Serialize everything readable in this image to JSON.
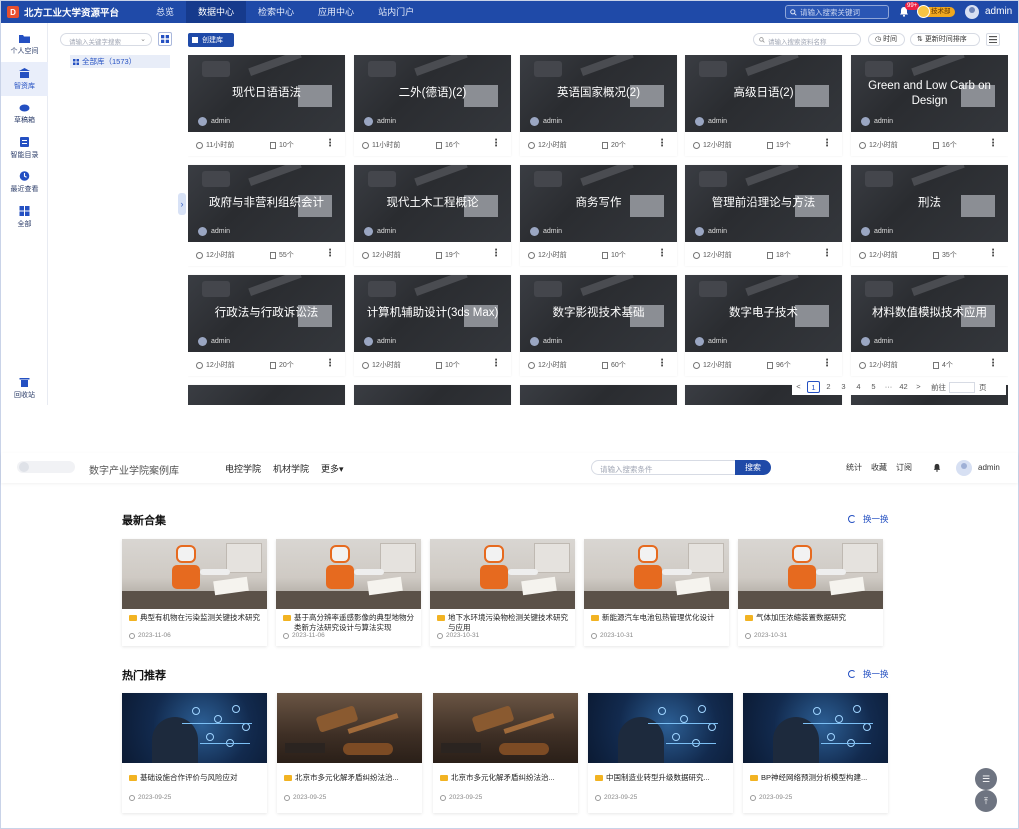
{
  "app": {
    "brand": "北方工业大学资源平台",
    "logo_letter": "D",
    "nav": [
      "总览",
      "数据中心",
      "检索中心",
      "应用中心",
      "站内门户"
    ],
    "nav_active": 1,
    "search_placeholder": "请输入搜索关键词",
    "notif_count": "99+",
    "vip_label": "技术部",
    "user": "admin"
  },
  "sidebar": [
    {
      "label": "个人空间",
      "icon": "folder-icon"
    },
    {
      "label": "智资库",
      "icon": "library-icon",
      "active": true
    },
    {
      "label": "草稿箱",
      "icon": "cloud-icon"
    },
    {
      "label": "智能目录",
      "icon": "catalog-icon"
    },
    {
      "label": "最近查看",
      "icon": "clock-icon"
    },
    {
      "label": "全部",
      "icon": "grid-icon"
    }
  ],
  "sidebar_bottom": {
    "label": "回收站",
    "icon": "trash-icon"
  },
  "tree": {
    "search_placeholder": "请输入关键字搜索",
    "root_label": "全部库（1573）"
  },
  "toolbar": {
    "new_lib": "创建库",
    "search_placeholder": "请输入搜索资料名称",
    "sort_time": "时间",
    "sort_update": "更新时间排序"
  },
  "cards": [
    {
      "title": "现代日语语法",
      "author": "admin",
      "time": "11小时前",
      "count": "10个"
    },
    {
      "title": "二外(德语)(2)",
      "author": "admin",
      "time": "11小时前",
      "count": "16个"
    },
    {
      "title": "英语国家概况(2)",
      "author": "admin",
      "time": "12小时前",
      "count": "20个"
    },
    {
      "title": "高级日语(2)",
      "author": "admin",
      "time": "12小时前",
      "count": "19个"
    },
    {
      "title": "Green and Low Carb on Design",
      "author": "admin",
      "time": "12小时前",
      "count": "16个"
    },
    {
      "title": "政府与非营利组织会计",
      "author": "admin",
      "time": "12小时前",
      "count": "55个"
    },
    {
      "title": "现代土木工程概论",
      "author": "admin",
      "time": "12小时前",
      "count": "19个"
    },
    {
      "title": "商务写作",
      "author": "admin",
      "time": "12小时前",
      "count": "10个"
    },
    {
      "title": "管理前沿理论与方法",
      "author": "admin",
      "time": "12小时前",
      "count": "18个"
    },
    {
      "title": "刑法",
      "author": "admin",
      "time": "12小时前",
      "count": "35个"
    },
    {
      "title": "行政法与行政诉讼法",
      "author": "admin",
      "time": "12小时前",
      "count": "20个"
    },
    {
      "title": "计算机辅助设计(3ds Max)",
      "author": "admin",
      "time": "12小时前",
      "count": "10个"
    },
    {
      "title": "数字影视技术基础",
      "author": "admin",
      "time": "12小时前",
      "count": "60个"
    },
    {
      "title": "数字电子技术",
      "author": "admin",
      "time": "12小时前",
      "count": "96个"
    },
    {
      "title": "材料数值模拟技术应用",
      "author": "admin",
      "time": "12小时前",
      "count": "4个"
    }
  ],
  "pager": {
    "prev": "<",
    "pages": [
      "1",
      "2",
      "3",
      "4",
      "5",
      "···",
      "42"
    ],
    "active": 0,
    "next": ">",
    "goto": "前往",
    "confirm": "页"
  },
  "portal": {
    "title": "数字产业学院案例库",
    "links": [
      "电控学院",
      "机材学院",
      "更多▾"
    ],
    "search_placeholder": "请输入搜索条件",
    "search_btn": "搜索",
    "right": [
      "统计",
      "收藏",
      "订阅"
    ],
    "user": "admin",
    "latest_title": "最新合集",
    "hot_title": "热门推荐",
    "refresh": "换一换",
    "latest": [
      {
        "title": "典型有机物在污染监测关键技术研究",
        "date": "2023-11-06"
      },
      {
        "title": "基于高分辨率遥感影像的典型地物分类新方法研究设计与算法实现",
        "date": "2023-11-06"
      },
      {
        "title": "地下水环境污染物检测关键技术研究与应用",
        "date": "2023-10-31"
      },
      {
        "title": "新能源汽车电池包热管理优化设计",
        "date": "2023-10-31"
      },
      {
        "title": "气体加压浓缩装置数据研究",
        "date": "2023-10-31"
      }
    ],
    "hot": [
      {
        "title": "基础设施合作评价与风险应对",
        "date": "2023-09-25",
        "img": "tech"
      },
      {
        "title": "北京市多元化解矛盾纠纷法治...",
        "date": "2023-09-25",
        "img": "gavel"
      },
      {
        "title": "北京市多元化解矛盾纠纷法治...",
        "date": "2023-09-25",
        "img": "gavel"
      },
      {
        "title": "中国制造业转型升级数据研究...",
        "date": "2023-09-25",
        "img": "tech"
      },
      {
        "title": "BP神经网络预测分析模型构建...",
        "date": "2023-09-25",
        "img": "tech"
      }
    ]
  },
  "colors": {
    "primary": "#1f4aa8",
    "accent": "#2450c2",
    "folder": "#f2b322"
  }
}
